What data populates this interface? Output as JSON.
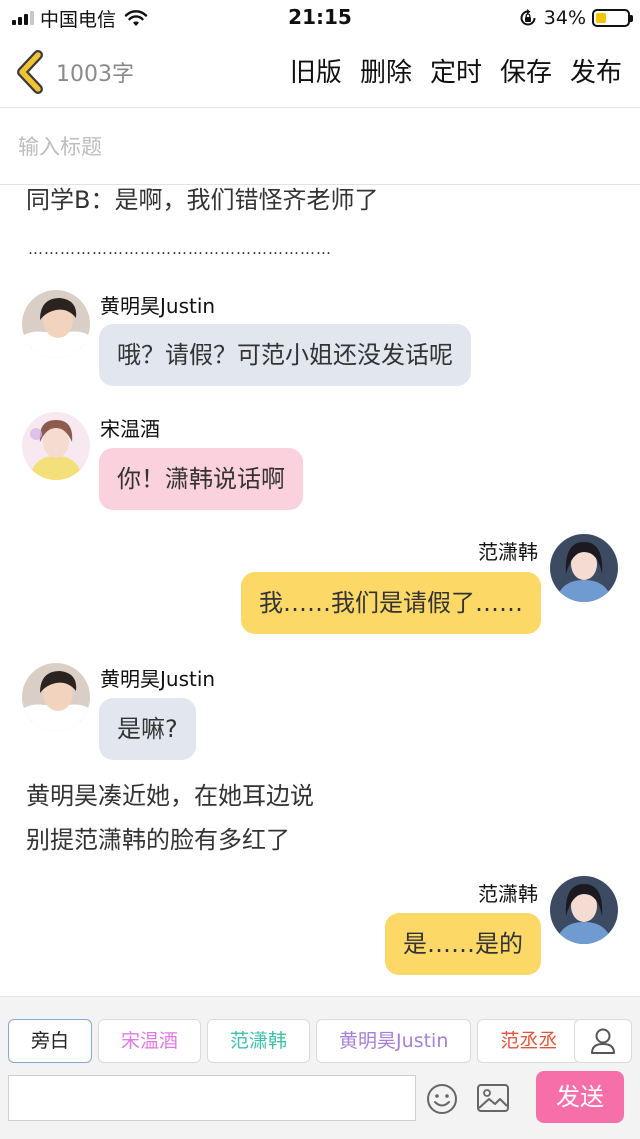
{
  "status_bar": {
    "carrier": "中国电信",
    "time": "21:15",
    "battery": "34%",
    "battery_level": 0.34
  },
  "nav": {
    "word_count": "1003字",
    "actions": [
      "旧版",
      "删除",
      "定时",
      "保存",
      "发布"
    ]
  },
  "title_input": {
    "placeholder": "输入标题",
    "value": ""
  },
  "content": {
    "narration_1": "同学B：是啊，我们错怪齐老师了",
    "dots": "…………………………………………………",
    "messages": [
      {
        "speaker": "黄明昊Justin",
        "text": "哦？请假？可范小姐还没发话呢"
      },
      {
        "speaker": "宋温酒",
        "text": "你！潇韩说话啊"
      },
      {
        "speaker": "范潇韩",
        "text": "我……我们是请假了……"
      },
      {
        "speaker": "黄明昊Justin",
        "text": "是嘛?"
      },
      {
        "speaker": "范潇韩",
        "text": "是……是的"
      }
    ],
    "narration_2": "黄明昊凑近她，在她耳边说",
    "narration_3": "别提范潇韩的脸有多红了"
  },
  "bottom_bar": {
    "chips": [
      {
        "label": "旁白",
        "color": "#222222"
      },
      {
        "label": "宋温酒",
        "color": "#e07be6"
      },
      {
        "label": "范潇韩",
        "color": "#3fbfae"
      },
      {
        "label": "黄明昊Justin",
        "color": "#a77fd6"
      },
      {
        "label": "范丞丞",
        "color": "#e0553a"
      }
    ],
    "input_value": "",
    "send_label": "发送"
  },
  "colors": {
    "bubble_gray": "#e2e6ee",
    "bubble_pink": "#fbd1dd",
    "bubble_yellow": "#fcd867",
    "send_button": "#f76fa8",
    "back_arrow": "#f1c232"
  },
  "icons": [
    "signal-icon",
    "wifi-icon",
    "rotation-lock-icon",
    "battery-icon",
    "back-arrow-icon",
    "person-icon",
    "emoji-icon",
    "image-icon"
  ]
}
